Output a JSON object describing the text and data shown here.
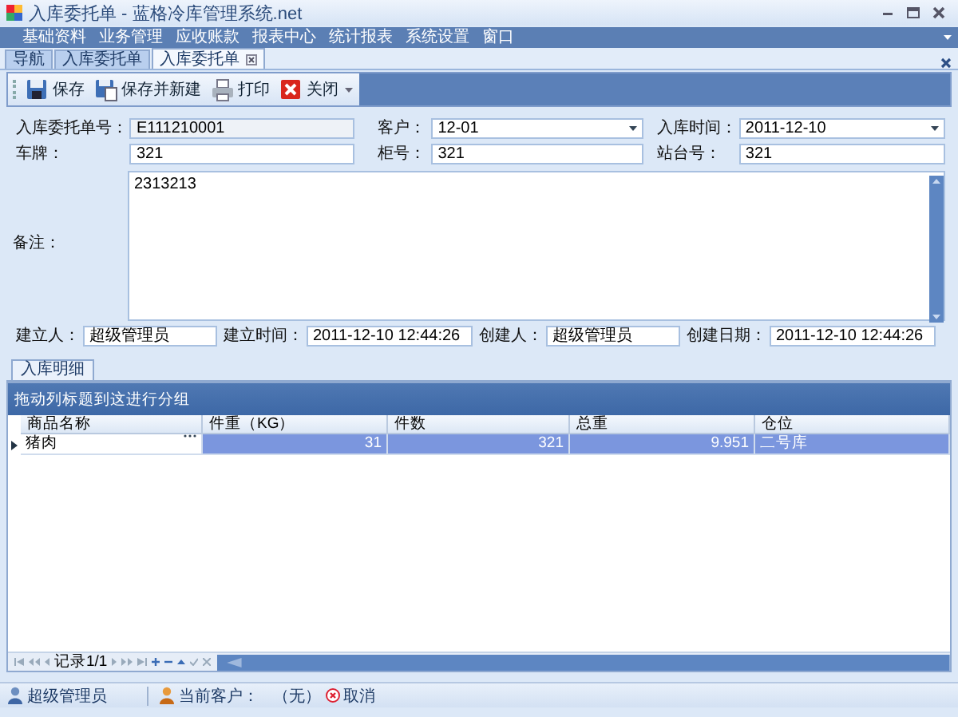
{
  "window": {
    "title": "入库委托单 - 蓝格冷库管理系统.net"
  },
  "menu": [
    "基础资料",
    "业务管理",
    "应收账款",
    "报表中心",
    "统计报表",
    "系统设置",
    "窗口"
  ],
  "doc_tabs": [
    {
      "label": "导航",
      "selected": false
    },
    {
      "label": "入库委托单",
      "selected": false
    },
    {
      "label": "入库委托单",
      "selected": true
    }
  ],
  "toolbar": [
    {
      "kind": "save",
      "label": "保存"
    },
    {
      "kind": "save_new",
      "label": "保存并新建"
    },
    {
      "kind": "print",
      "label": "打印"
    },
    {
      "kind": "close",
      "label": "关闭"
    }
  ],
  "form": {
    "rows": [
      [
        {
          "label": "入库委托单号：",
          "value": "E111210001",
          "kind": "readonly"
        },
        {
          "label": "客户：",
          "value": "12-01",
          "kind": "dropdown"
        },
        {
          "label": "入库时间：",
          "value": "2011-12-10",
          "kind": "dropdown"
        }
      ],
      [
        {
          "label": "车牌：",
          "value": "321",
          "kind": "text"
        },
        {
          "label": "柜号：",
          "value": "321",
          "kind": "text"
        },
        {
          "label": "站台号：",
          "value": "321",
          "kind": "text"
        }
      ],
      [
        {
          "label": "备注：",
          "value": "2313213",
          "kind": "memo"
        }
      ],
      [
        {
          "label": "建立人：",
          "value": "超级管理员",
          "kind": "text"
        },
        {
          "label": "建立时间：",
          "value": "2011-12-10 12:44:26",
          "kind": "text"
        },
        {
          "label": "创建人：",
          "value": "超级管理员",
          "kind": "text"
        },
        {
          "label": "创建日期：",
          "value": "2011-12-10 12:44:26",
          "kind": "text"
        }
      ]
    ]
  },
  "detail_tabs": [
    {
      "label": "入库明细",
      "selected": true
    }
  ],
  "grid": {
    "group_hint": "拖动列标题到这进行分组",
    "columns": [
      {
        "label": "商品名称",
        "kind": "text"
      },
      {
        "label": "件重（KG）",
        "kind": "number"
      },
      {
        "label": "件数",
        "kind": "number"
      },
      {
        "label": "总重",
        "kind": "number"
      },
      {
        "label": "仓位",
        "kind": "text"
      }
    ],
    "rows": [
      {
        "selected": true,
        "cells": [
          "猪肉",
          "31",
          "321",
          "9.951",
          "二号库"
        ]
      }
    ],
    "record": "记录1/1"
  },
  "status_bar": {
    "user": "超级管理员",
    "customer_label": "当前客户：",
    "customer_value": "（无）",
    "cancel": "取消"
  }
}
